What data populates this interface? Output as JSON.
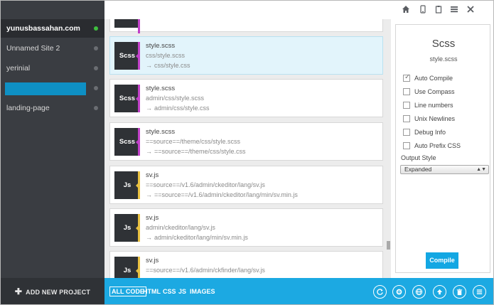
{
  "sidebar": {
    "sites": [
      {
        "name": "yunusbassahan.com",
        "active": true
      },
      {
        "name": "Unnamed Site 2",
        "active": false
      },
      {
        "name": "yerinial",
        "active": false
      },
      {
        "name": "",
        "editing": true
      },
      {
        "name": "landing-page",
        "active": false
      }
    ],
    "add_project_label": "ADD NEW PROJECT"
  },
  "topbar": {
    "icons": [
      "home-icon",
      "mobile-icon",
      "clipboard-icon",
      "menu-icon",
      "close-icon"
    ]
  },
  "files": [
    {
      "type": "Scss",
      "name": "style.scss",
      "source": "css/style.scss",
      "output": "css/style.css",
      "selected": true,
      "color": "#c040c8"
    },
    {
      "type": "Scss",
      "name": "style.scss",
      "source": "admin/css/style.scss",
      "output": "admin/css/style.css",
      "selected": false,
      "color": "#c040c8"
    },
    {
      "type": "Scss",
      "name": "style.scss",
      "source": "==source==/theme/css/style.scss",
      "output": "==source==/theme/css/style.css",
      "selected": false,
      "color": "#c040c8"
    },
    {
      "type": "Js",
      "name": "sv.js",
      "source": "==source==/v1.6/admin/ckeditor/lang/sv.js",
      "output": "==source==/v1.6/admin/ckeditor/lang/min/sv.min.js",
      "selected": false,
      "color": "#e8c040"
    },
    {
      "type": "Js",
      "name": "sv.js",
      "source": "admin/ckeditor/lang/sv.js",
      "output": "admin/ckeditor/lang/min/sv.min.js",
      "selected": false,
      "color": "#e8c040"
    },
    {
      "type": "Js",
      "name": "sv.js",
      "source": "==source==/v1.6/admin/ckfinder/lang/sv.js",
      "output": "",
      "selected": false,
      "color": "#e8c040"
    }
  ],
  "partial_top_card": {
    "type": "",
    "color": "#c040c8"
  },
  "arrow_glyph": "→",
  "panel": {
    "title": "Scss",
    "filename": "style.scss",
    "options": [
      {
        "label": "Auto Compile",
        "checked": true
      },
      {
        "label": "Use Compass",
        "checked": false
      },
      {
        "label": "Line numbers",
        "checked": false
      },
      {
        "label": "Unix Newlines",
        "checked": false
      },
      {
        "label": "Debug Info",
        "checked": false
      },
      {
        "label": "Auto Prefix CSS",
        "checked": false
      }
    ],
    "output_style_label": "Output Style",
    "output_style_value": "Expanded",
    "compile_label": "Compile"
  },
  "bottombar": {
    "filters": [
      {
        "label": "ALL CODE",
        "active": true
      },
      {
        "label": "HTML",
        "active": false
      },
      {
        "label": "CSS",
        "active": false
      },
      {
        "label": "JS",
        "active": false
      },
      {
        "label": "IMAGES",
        "active": false
      }
    ],
    "buttons": [
      "refresh-icon",
      "settings-icon",
      "globe-icon",
      "upload-icon",
      "trash-icon",
      "list-icon"
    ]
  },
  "colors": {
    "accent": "#1ca9e2",
    "sidebar_bg": "#3a3d42",
    "active_dot": "#3fbf3f",
    "scss_stripe": "#c040c8",
    "js_stripe": "#e8c040"
  }
}
